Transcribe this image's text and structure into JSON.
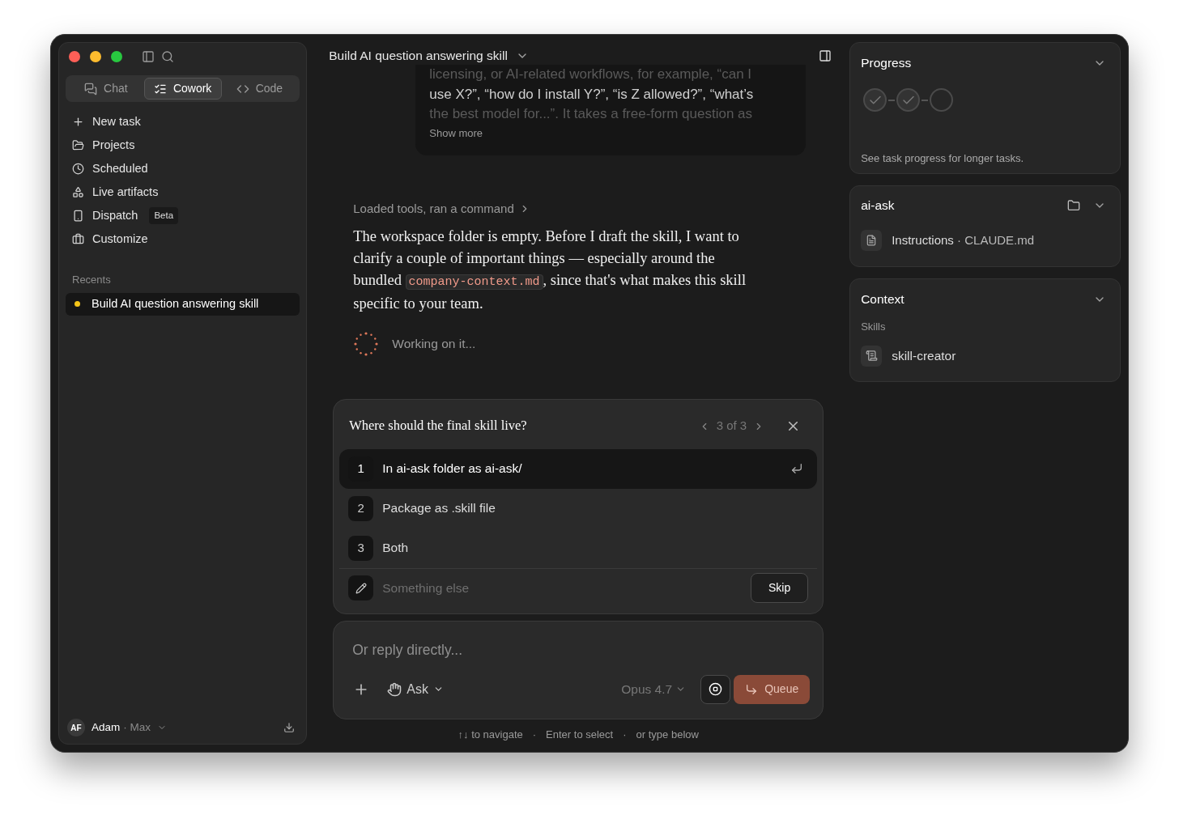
{
  "sidebar": {
    "modes": [
      {
        "label": "Chat",
        "selected": false
      },
      {
        "label": "Cowork",
        "selected": true
      },
      {
        "label": "Code",
        "selected": false
      }
    ],
    "nav": [
      {
        "label": "New task"
      },
      {
        "label": "Projects"
      },
      {
        "label": "Scheduled"
      },
      {
        "label": "Live artifacts"
      },
      {
        "label": "Dispatch",
        "badge": "Beta"
      },
      {
        "label": "Customize"
      }
    ],
    "recents_heading": "Recents",
    "recents": [
      {
        "label": "Build AI question answering skill",
        "selected": true,
        "color": "#f5c518"
      }
    ],
    "user": {
      "initials": "AF",
      "name": "Adam",
      "plan": "Max",
      "separator": "·"
    }
  },
  "header": {
    "title": "Build AI question answering skill"
  },
  "user_message": {
    "lines": [
      "licensing, or AI-related workflows, for example, “can I",
      "use X?”, “how do I install Y?”, “is Z allowed?”, “what’s",
      "the best model for...”. It takes a free-form question as"
    ],
    "show_more": "Show more"
  },
  "tool_summary": "Loaded tools, ran a command",
  "reply": {
    "before": "The workspace folder is empty. Before I draft the skill, I want to clarify a couple of important things — especially around the bundled",
    "code": "company-context.md",
    "after": ", since that's what makes this skill specific to your team."
  },
  "status": "Working on it...",
  "question": {
    "text": "Where should the final skill live?",
    "pager": "3 of 3",
    "options": [
      {
        "number": "1",
        "label": "In ai-ask folder as ai-ask/",
        "selected": true
      },
      {
        "number": "2",
        "label": "Package as .skill file",
        "selected": false
      },
      {
        "number": "3",
        "label": "Both",
        "selected": false
      }
    ],
    "other_placeholder": "Something else",
    "skip": "Skip"
  },
  "composer": {
    "placeholder": "Or reply directly...",
    "mode": "Ask",
    "model": "Opus 4.7",
    "queue": "Queue"
  },
  "hints": {
    "items": [
      "↑↓ to navigate",
      "Enter to select",
      "or type below"
    ],
    "separator": "·"
  },
  "panels": {
    "progress": {
      "title": "Progress",
      "steps": [
        {
          "done": true
        },
        {
          "done": true
        },
        {
          "done": false
        }
      ],
      "caption": "See task progress for longer tasks."
    },
    "folder": {
      "title": "ai-ask",
      "file": "Instructions",
      "separator": "·",
      "file_name": "CLAUDE.md"
    },
    "context": {
      "title": "Context",
      "heading": "Skills",
      "items": [
        "skill-creator"
      ]
    }
  }
}
